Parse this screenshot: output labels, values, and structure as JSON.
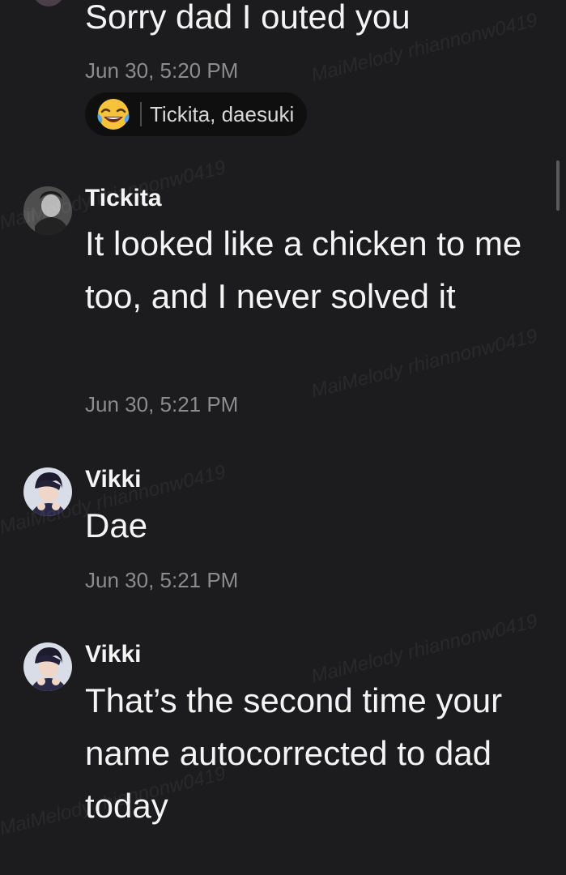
{
  "messages": [
    {
      "body": "Sorry dad I outed you",
      "timestamp": "Jun 30, 5:20 PM",
      "reaction": {
        "emoji": "laughing-tears-emoji",
        "names": "Tickita, daesuki"
      }
    },
    {
      "sender": "Tickita",
      "body": "It looked like a chicken to me too, and I never solved it",
      "timestamp": "Jun 30, 5:21 PM"
    },
    {
      "sender": "Vikki",
      "body": "Dae",
      "timestamp": "Jun 30, 5:21 PM"
    },
    {
      "sender": "Vikki",
      "body": "That’s the second time your name autocorrected to dad today"
    }
  ],
  "watermark": {
    "text": "MaiMelody rhiannonw0419"
  },
  "colors": {
    "background": "#1c1c1e",
    "text": "#f4f4f4",
    "timestamp": "#8c8c8e",
    "reaction_pill": "#0f0f10"
  }
}
